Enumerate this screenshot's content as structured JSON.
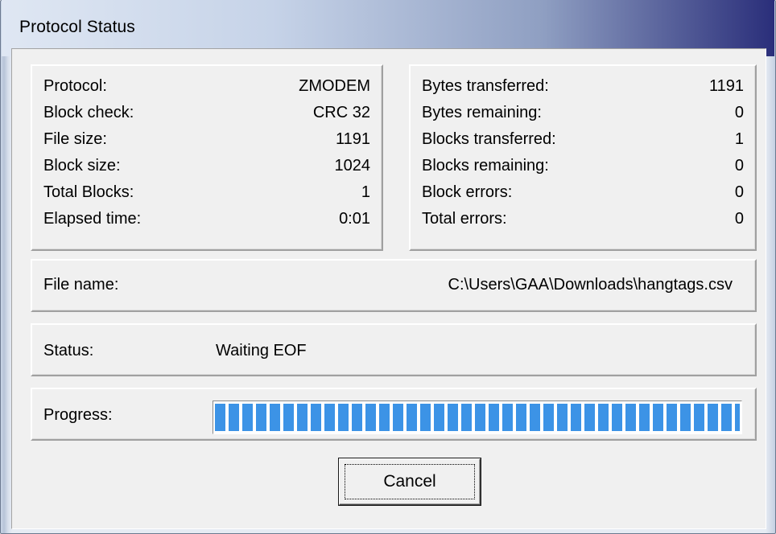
{
  "window": {
    "title": "Protocol Status"
  },
  "info_left": [
    {
      "label": "Protocol:",
      "value": "ZMODEM"
    },
    {
      "label": "Block check:",
      "value": "CRC 32"
    },
    {
      "label": "File size:",
      "value": "1191"
    },
    {
      "label": "Block size:",
      "value": "1024"
    },
    {
      "label": "Total Blocks:",
      "value": "1"
    },
    {
      "label": "Elapsed time:",
      "value": "0:01"
    }
  ],
  "info_right": [
    {
      "label": "Bytes transferred:",
      "value": "1191"
    },
    {
      "label": "Bytes remaining:",
      "value": "0"
    },
    {
      "label": "Blocks transferred:",
      "value": "1"
    },
    {
      "label": "Blocks remaining:",
      "value": "0"
    },
    {
      "label": "Block errors:",
      "value": "0"
    },
    {
      "label": "Total errors:",
      "value": "0"
    }
  ],
  "file": {
    "label": "File name:",
    "value": "C:\\Users\\GAA\\Downloads\\hangtags.csv"
  },
  "status": {
    "label": "Status:",
    "value": "Waiting EOF"
  },
  "progress": {
    "label": "Progress:",
    "percent": 100
  },
  "buttons": {
    "cancel_label": "Cancel"
  },
  "colors": {
    "progress_fill": "#3c93e6",
    "dialog_background": "#f0f0f0",
    "titlebar_dark": "#2a2e7a"
  }
}
